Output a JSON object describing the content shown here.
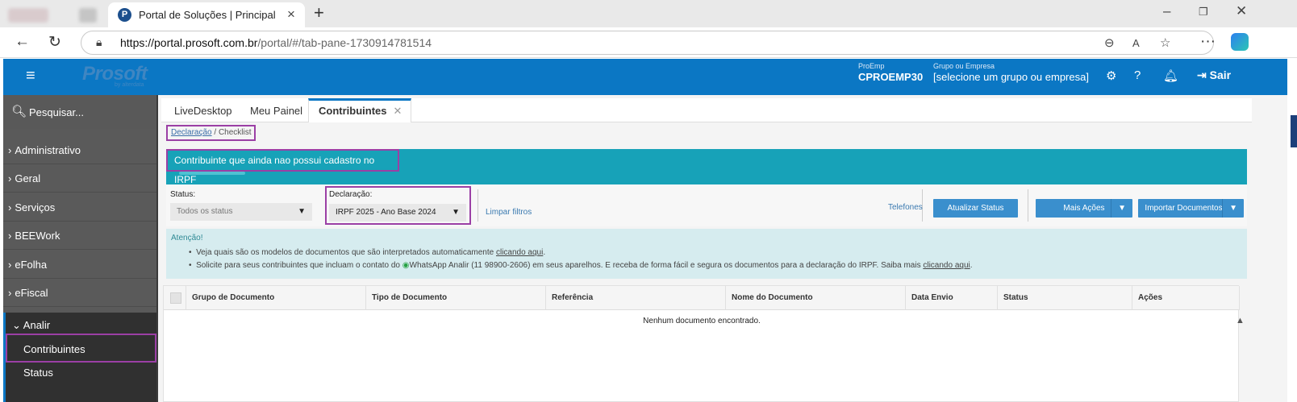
{
  "browser": {
    "tab_title": "Portal de Soluções | Principal",
    "url_host": "https://portal.prosoft.com.br",
    "url_path": "/portal/#/tab-pane-1730914781514"
  },
  "header": {
    "logo": "Prosoft",
    "logo_sub": "by alterdata",
    "proemp_label": "ProEmp",
    "proemp_value": "CPROEMP30",
    "grupo_label": "Grupo ou Empresa",
    "grupo_value": "[selecione um grupo ou empresa]",
    "logout": "Sair"
  },
  "sidebar": {
    "search_placeholder": "Pesquisar...",
    "items": [
      {
        "label": "Administrativo"
      },
      {
        "label": "Geral"
      },
      {
        "label": "Serviços"
      },
      {
        "label": "BEEWork"
      },
      {
        "label": "eFolha"
      },
      {
        "label": "eFiscal"
      }
    ],
    "group": {
      "label": "Analir",
      "children": [
        {
          "label": "Contribuintes"
        },
        {
          "label": "Status"
        }
      ]
    }
  },
  "tabs": [
    {
      "label": "LiveDesktop"
    },
    {
      "label": "Meu Painel"
    },
    {
      "label": "Contribuintes"
    }
  ],
  "breadcrumb": {
    "root": "Declaração",
    "separator": "/",
    "current": "Checklist"
  },
  "banner": {
    "title": "Contribuinte que ainda nao possui cadastro no IRPF"
  },
  "filters": {
    "status_label": "Status:",
    "status_value": "Todos os status",
    "declaracao_label": "Declaração:",
    "declaracao_value": "IRPF 2025 - Ano Base 2024",
    "clear": "Limpar filtros",
    "telefones": "Telefones",
    "update_status": "Atualizar Status",
    "more_actions": "Mais Ações",
    "import_docs": "Importar Documentos"
  },
  "attention": {
    "title": "Atenção!",
    "line1_prefix": "Veja quais são os modelos de documentos que são interpretados automaticamente",
    "line1_link": "clicando aqui",
    "line1_suffix": ".",
    "line2_prefix": "Solicite para seus contribuintes que incluam o contato do",
    "line2_mid": "WhatsApp Analir (11 98900-2606) em seus aparelhos. E receba de forma fácil e segura os documentos para a declaração do IRPF. Saiba mais",
    "line2_link": "clicando aqui",
    "line2_suffix": "."
  },
  "table": {
    "columns": [
      "Grupo de Documento",
      "Tipo de Documento",
      "Referência",
      "Nome do Documento",
      "Data Envio",
      "Status",
      "Ações"
    ],
    "empty_message": "Nenhum documento encontrado."
  },
  "colors": {
    "header_blue": "#0b77c4",
    "banner_teal": "#17a2b8",
    "highlight_purple": "#9b3fa5",
    "button_blue": "#3a8fcd"
  },
  "icons": [
    "hamburger-icon",
    "search-icon",
    "gear-icon",
    "help-icon",
    "bell-icon",
    "logout-icon",
    "lock-icon",
    "back-icon",
    "refresh-icon",
    "whatsapp-icon"
  ]
}
